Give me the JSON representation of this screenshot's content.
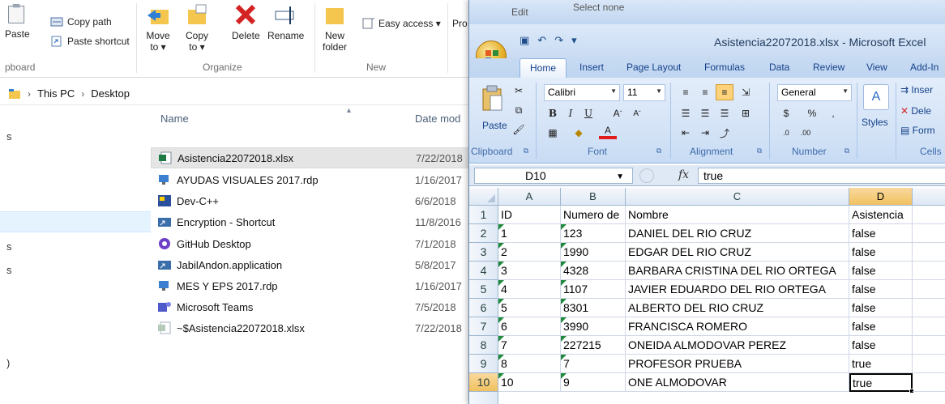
{
  "explorer": {
    "ribbon": {
      "paste_label": "Paste",
      "copy_path_label": "Copy path",
      "paste_shortcut_label": "Paste shortcut",
      "move_to_label": "Move\nto ▾",
      "copy_to_label": "Copy\nto ▾",
      "delete_label": "Delete",
      "rename_label": "Rename",
      "new_folder_label": "New\nfolder",
      "easy_access_label": "Easy access ▾",
      "properties_fragment": "Pro",
      "edit_fragment": "Edit",
      "select_none_label": "Select none",
      "group_clipboard": "pboard",
      "group_organize": "Organize",
      "group_new": "New"
    },
    "breadcrumb": [
      "This PC",
      "Desktop"
    ],
    "nav_fragments": [
      "s",
      "s",
      "s",
      ")"
    ],
    "columns": {
      "name": "Name",
      "date": "Date mod"
    },
    "files": [
      {
        "name": "Asistencia22072018.xlsx",
        "date": "7/22/2018",
        "icon": "excel-file-icon"
      },
      {
        "name": "AYUDAS VISUALES 2017.rdp",
        "date": "1/16/2017",
        "icon": "remote-desktop-icon"
      },
      {
        "name": "Dev-C++",
        "date": "6/6/2018",
        "icon": "devcpp-icon"
      },
      {
        "name": "Encryption - Shortcut",
        "date": "11/8/2016",
        "icon": "shortcut-icon"
      },
      {
        "name": "GitHub Desktop",
        "date": "7/1/2018",
        "icon": "github-icon"
      },
      {
        "name": "JabilAndon.application",
        "date": "5/8/2017",
        "icon": "application-icon"
      },
      {
        "name": "MES Y EPS 2017.rdp",
        "date": "1/16/2017",
        "icon": "remote-desktop-icon"
      },
      {
        "name": "Microsoft Teams",
        "date": "7/5/2018",
        "icon": "teams-icon"
      },
      {
        "name": "~$Asistencia22072018.xlsx",
        "date": "7/22/2018",
        "icon": "temp-file-icon"
      }
    ]
  },
  "excel": {
    "title": "Asistencia22072018.xlsx - Microsoft Excel",
    "tabs": [
      "Home",
      "Insert",
      "Page Layout",
      "Formulas",
      "Data",
      "Review",
      "View",
      "Add-In"
    ],
    "ribbon": {
      "paste_label": "Paste",
      "font_name": "Calibri",
      "font_size": "11",
      "number_format": "General",
      "styles_label": "Styles",
      "insert_label": "Inser",
      "delete_label": "Dele",
      "format_label": "Form",
      "groups": {
        "clipboard": "Clipboard",
        "font": "Font",
        "alignment": "Alignment",
        "number": "Number",
        "cells": "Cells"
      },
      "glyphs": {
        "bold": "B",
        "italic": "I",
        "underline": "U",
        "grow_font": "A",
        "shrink_font": "A",
        "currency": "$",
        "percent": "%",
        "comma": ",",
        "inc_decimal": ".0",
        "dec_decimal": ".00"
      }
    },
    "name_box": "D10",
    "fx_label": "fx",
    "formula": "true",
    "columns": [
      "A",
      "B",
      "C",
      "D"
    ],
    "rows": [
      {
        "num": "1",
        "A": "ID",
        "B": "Numero de",
        "C": "Nombre",
        "D": "Asistencia",
        "tri": false
      },
      {
        "num": "2",
        "A": "1",
        "B": "123",
        "C": "DANIEL DEL RIO CRUZ",
        "D": "false",
        "tri": true
      },
      {
        "num": "3",
        "A": "2",
        "B": "1990",
        "C": "EDGAR DEL RIO CRUZ",
        "D": "false",
        "tri": true
      },
      {
        "num": "4",
        "A": "3",
        "B": "4328",
        "C": "BARBARA CRISTINA DEL RIO ORTEGA",
        "D": "false",
        "tri": true
      },
      {
        "num": "5",
        "A": "4",
        "B": "1107",
        "C": "JAVIER EDUARDO DEL RIO ORTEGA",
        "D": "false",
        "tri": true
      },
      {
        "num": "6",
        "A": "5",
        "B": "8301",
        "C": "ALBERTO DEL RIO CRUZ",
        "D": "false",
        "tri": true
      },
      {
        "num": "7",
        "A": "6",
        "B": "3990",
        "C": "FRANCISCA ROMERO",
        "D": "false",
        "tri": true
      },
      {
        "num": "8",
        "A": "7",
        "B": "227215",
        "C": "ONEIDA ALMODOVAR PEREZ",
        "D": "false",
        "tri": true
      },
      {
        "num": "9",
        "A": "8",
        "B": "7",
        "C": "PROFESOR PRUEBA",
        "D": "true",
        "tri": true
      },
      {
        "num": "10",
        "A": "10",
        "B": "9",
        "C": "ONE ALMODOVAR",
        "D": "true",
        "tri": true
      }
    ],
    "active_cell": {
      "row": "10",
      "col": "D"
    },
    "colors": {
      "title_text": "#1e395b",
      "tab_text": "#15428b",
      "error_triangle": "#1f8a3b",
      "selected_header": "#f1c15f"
    }
  }
}
